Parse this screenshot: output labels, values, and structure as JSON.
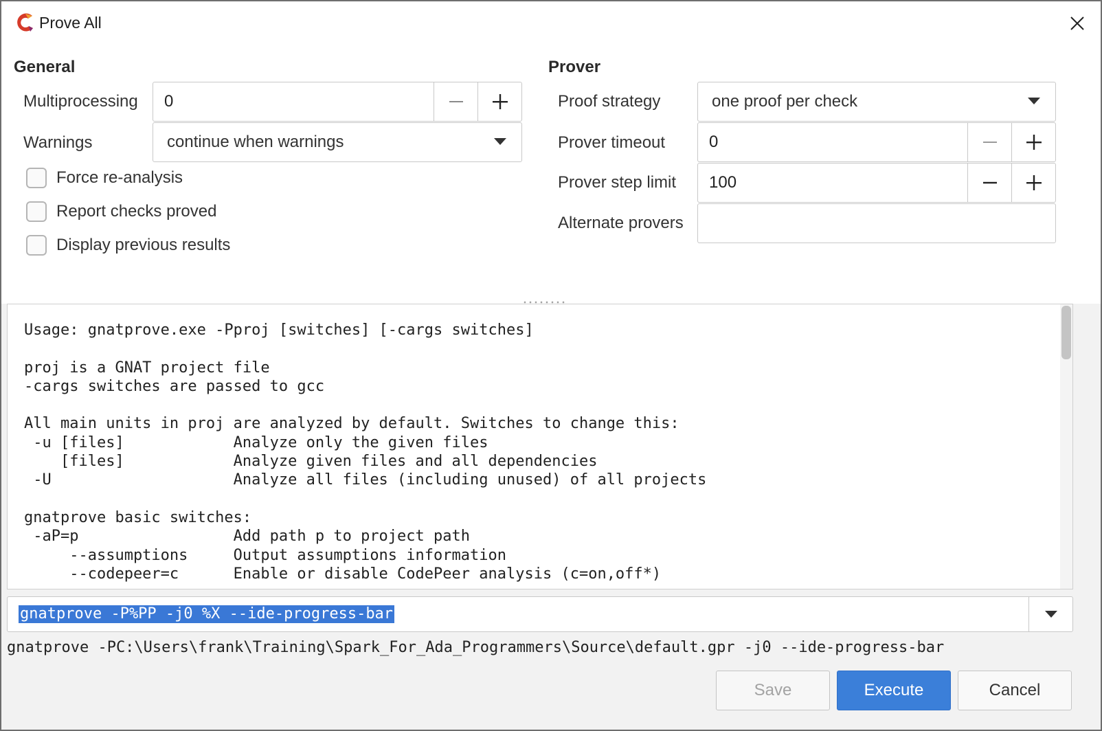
{
  "window": {
    "title": "Prove All",
    "icon": "gnat-studio-logo-icon"
  },
  "general": {
    "title": "General",
    "multiprocessing": {
      "label": "Multiprocessing",
      "value": "0"
    },
    "warnings": {
      "label": "Warnings",
      "value": "continue when warnings"
    },
    "checkboxes": [
      {
        "label": "Force re-analysis",
        "checked": false
      },
      {
        "label": "Report checks proved",
        "checked": false
      },
      {
        "label": "Display previous results",
        "checked": false
      }
    ]
  },
  "prover": {
    "title": "Prover",
    "proof_strategy": {
      "label": "Proof strategy",
      "value": "one proof per check"
    },
    "prover_timeout": {
      "label": "Prover timeout",
      "value": "0"
    },
    "prover_step_limit": {
      "label": "Prover step limit",
      "value": "100"
    },
    "alternate_provers": {
      "label": "Alternate provers",
      "value": ""
    }
  },
  "usage_text": "Usage: gnatprove.exe -Pproj [switches] [-cargs switches]\n\nproj is a GNAT project file\n-cargs switches are passed to gcc\n\nAll main units in proj are analyzed by default. Switches to change this:\n -u [files]            Analyze only the given files\n    [files]            Analyze given files and all dependencies\n -U                    Analyze all files (including unused) of all projects\n\ngnatprove basic switches:\n -aP=p                 Add path p to project path\n     --assumptions     Output assumptions information\n     --codepeer=c      Enable or disable CodePeer analysis (c=on,off*)",
  "command": {
    "value": "gnatprove -P%PP -j0 %X --ide-progress-bar",
    "expanded": "gnatprove -PC:\\Users\\frank\\Training\\Spark_For_Ada_Programmers\\Source\\default.gpr -j0 --ide-progress-bar"
  },
  "buttons": {
    "save": "Save",
    "execute": "Execute",
    "cancel": "Cancel"
  },
  "colors": {
    "accent": "#3b7fd9",
    "selection": "#3a78d6",
    "logo_red": "#d63b2a"
  }
}
